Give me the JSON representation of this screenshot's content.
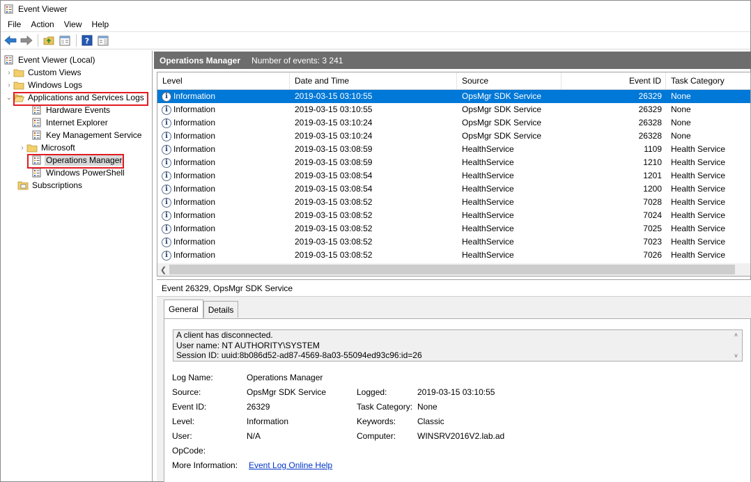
{
  "window": {
    "title": "Event Viewer"
  },
  "menu": [
    "File",
    "Action",
    "View",
    "Help"
  ],
  "tree": {
    "root": "Event Viewer (Local)",
    "custom_views": "Custom Views",
    "windows_logs": "Windows Logs",
    "apps_services": "Applications and Services Logs",
    "hardware_events": "Hardware Events",
    "internet_explorer": "Internet Explorer",
    "key_management": "Key Management Service",
    "microsoft": "Microsoft",
    "operations_manager": "Operations Manager",
    "powershell": "Windows PowerShell",
    "subscriptions": "Subscriptions"
  },
  "content": {
    "title": "Operations Manager",
    "event_count": "Number of events: 3 241"
  },
  "columns": [
    "Level",
    "Date and Time",
    "Source",
    "Event ID",
    "Task Category"
  ],
  "events": [
    {
      "level": "Information",
      "date": "2019-03-15 03:10:55",
      "source": "OpsMgr SDK Service",
      "id": "26329",
      "category": "None"
    },
    {
      "level": "Information",
      "date": "2019-03-15 03:10:55",
      "source": "OpsMgr SDK Service",
      "id": "26329",
      "category": "None"
    },
    {
      "level": "Information",
      "date": "2019-03-15 03:10:24",
      "source": "OpsMgr SDK Service",
      "id": "26328",
      "category": "None"
    },
    {
      "level": "Information",
      "date": "2019-03-15 03:10:24",
      "source": "OpsMgr SDK Service",
      "id": "26328",
      "category": "None"
    },
    {
      "level": "Information",
      "date": "2019-03-15 03:08:59",
      "source": "HealthService",
      "id": "1109",
      "category": "Health Service"
    },
    {
      "level": "Information",
      "date": "2019-03-15 03:08:59",
      "source": "HealthService",
      "id": "1210",
      "category": "Health Service"
    },
    {
      "level": "Information",
      "date": "2019-03-15 03:08:54",
      "source": "HealthService",
      "id": "1201",
      "category": "Health Service"
    },
    {
      "level": "Information",
      "date": "2019-03-15 03:08:54",
      "source": "HealthService",
      "id": "1200",
      "category": "Health Service"
    },
    {
      "level": "Information",
      "date": "2019-03-15 03:08:52",
      "source": "HealthService",
      "id": "7028",
      "category": "Health Service"
    },
    {
      "level": "Information",
      "date": "2019-03-15 03:08:52",
      "source": "HealthService",
      "id": "7024",
      "category": "Health Service"
    },
    {
      "level": "Information",
      "date": "2019-03-15 03:08:52",
      "source": "HealthService",
      "id": "7025",
      "category": "Health Service"
    },
    {
      "level": "Information",
      "date": "2019-03-15 03:08:52",
      "source": "HealthService",
      "id": "7023",
      "category": "Health Service"
    },
    {
      "level": "Information",
      "date": "2019-03-15 03:08:52",
      "source": "HealthService",
      "id": "7026",
      "category": "Health Service"
    }
  ],
  "details": {
    "title": "Event 26329, OpsMgr SDK Service",
    "tabs": [
      "General",
      "Details"
    ],
    "message": [
      "A client has disconnected.",
      "User name: NT AUTHORITY\\SYSTEM",
      "Session ID: uuid:8b086d52-ad87-4569-8a03-55094ed93c96:id=26"
    ],
    "labels": {
      "log_name": "Log Name:",
      "source": "Source:",
      "event_id": "Event ID:",
      "level": "Level:",
      "user": "User:",
      "opcode": "OpCode:",
      "more_info": "More Information:",
      "logged": "Logged:",
      "task_category": "Task Category:",
      "keywords": "Keywords:",
      "computer": "Computer:"
    },
    "values": {
      "log_name": "Operations Manager",
      "source": "OpsMgr SDK Service",
      "event_id": "26329",
      "level": "Information",
      "user": "N/A",
      "opcode": "",
      "more_info": "Event Log Online Help",
      "logged": "2019-03-15 03:10:55",
      "task_category": "None",
      "keywords": "Classic",
      "computer": "WINSRV2016V2.lab.ad"
    }
  },
  "colors": {
    "selection": "#0078d7",
    "header_bar": "#6d6d6d",
    "highlight_box": "#e11b22",
    "link": "#0033cc"
  }
}
